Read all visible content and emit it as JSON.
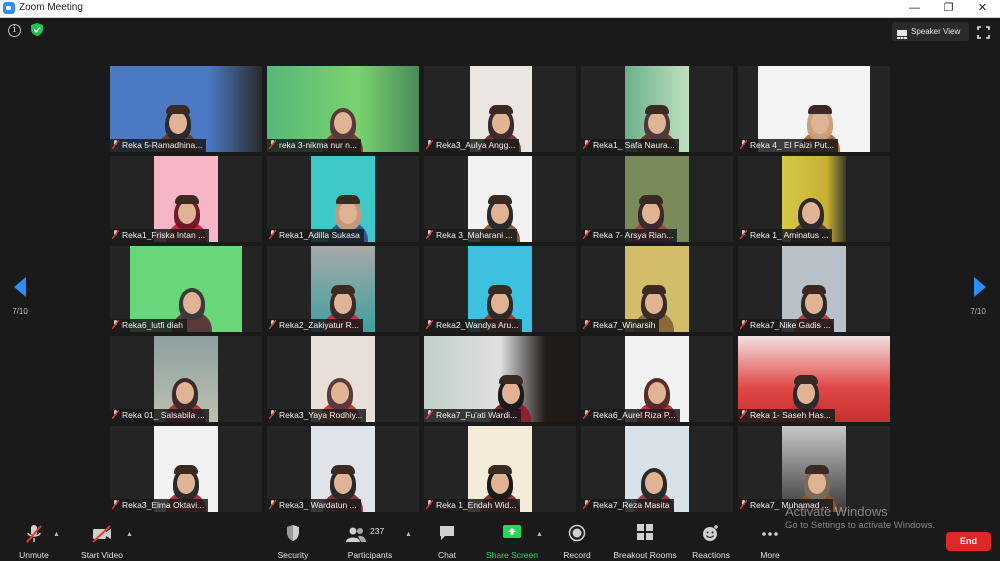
{
  "window": {
    "title": "Zoom Meeting",
    "minimize": "—",
    "maximize": "❐",
    "close": "✕"
  },
  "topbar": {
    "speaker_view": "Speaker View",
    "info_icon": "info-icon",
    "shield_icon": "shield-icon"
  },
  "pager": {
    "left": "7/10",
    "right": "7/10"
  },
  "participants": [
    {
      "name": "Reka 5-Ramadhina..."
    },
    {
      "name": "reka 3-nikma nur n..."
    },
    {
      "name": "Reka3_Aulya Angg..."
    },
    {
      "name": "Reka1_ Safa Naura..."
    },
    {
      "name": "Reka 4_ El Faizi Put..."
    },
    {
      "name": "Reka1_Friska Intan ..."
    },
    {
      "name": "Reka1_Adilla Sukasa"
    },
    {
      "name": "Reka 3_Maharani ..."
    },
    {
      "name": "Reka 7- Arsya Rian..."
    },
    {
      "name": "Reka 1_ Aminatus ..."
    },
    {
      "name": "Reka6_lutfi diah"
    },
    {
      "name": "Reka2_Zakiyatur R..."
    },
    {
      "name": "Reka2_Wandya Aru..."
    },
    {
      "name": "Reka7_Winarsih"
    },
    {
      "name": "Reka7_Nike Gadis ..."
    },
    {
      "name": "Reka 01_ Salsabila ..."
    },
    {
      "name": "Reka3_Yaya Rodhiy..."
    },
    {
      "name": "Reka7_Fu'ati Wardi..."
    },
    {
      "name": "Reka6_Aurel Riza P..."
    },
    {
      "name": "Reka 1- Saseh Has..."
    },
    {
      "name": "Reka3_Elma Oktavi..."
    },
    {
      "name": "Reka3_ Wardatun ..."
    },
    {
      "name": "Reka 1_Endah Wid..."
    },
    {
      "name": "Reka7_Reza Masita"
    },
    {
      "name": "Reka7_ Muhamad ..."
    }
  ],
  "toolbar": {
    "unmute": "Unmute",
    "start_video": "Start Video",
    "security": "Security",
    "participants": "Participants",
    "participants_count": "237",
    "chat": "Chat",
    "share_screen": "Share Screen",
    "record": "Record",
    "breakout_rooms": "Breakout Rooms",
    "reactions": "Reactions",
    "more": "More",
    "end": "End"
  },
  "watermark": {
    "line1": "Activate Windows",
    "line2": "Go to Settings to activate Windows."
  },
  "colors": {
    "accent": "#2d8cff",
    "end": "#e02828",
    "share": "#23d959",
    "muted": "#e53935"
  }
}
